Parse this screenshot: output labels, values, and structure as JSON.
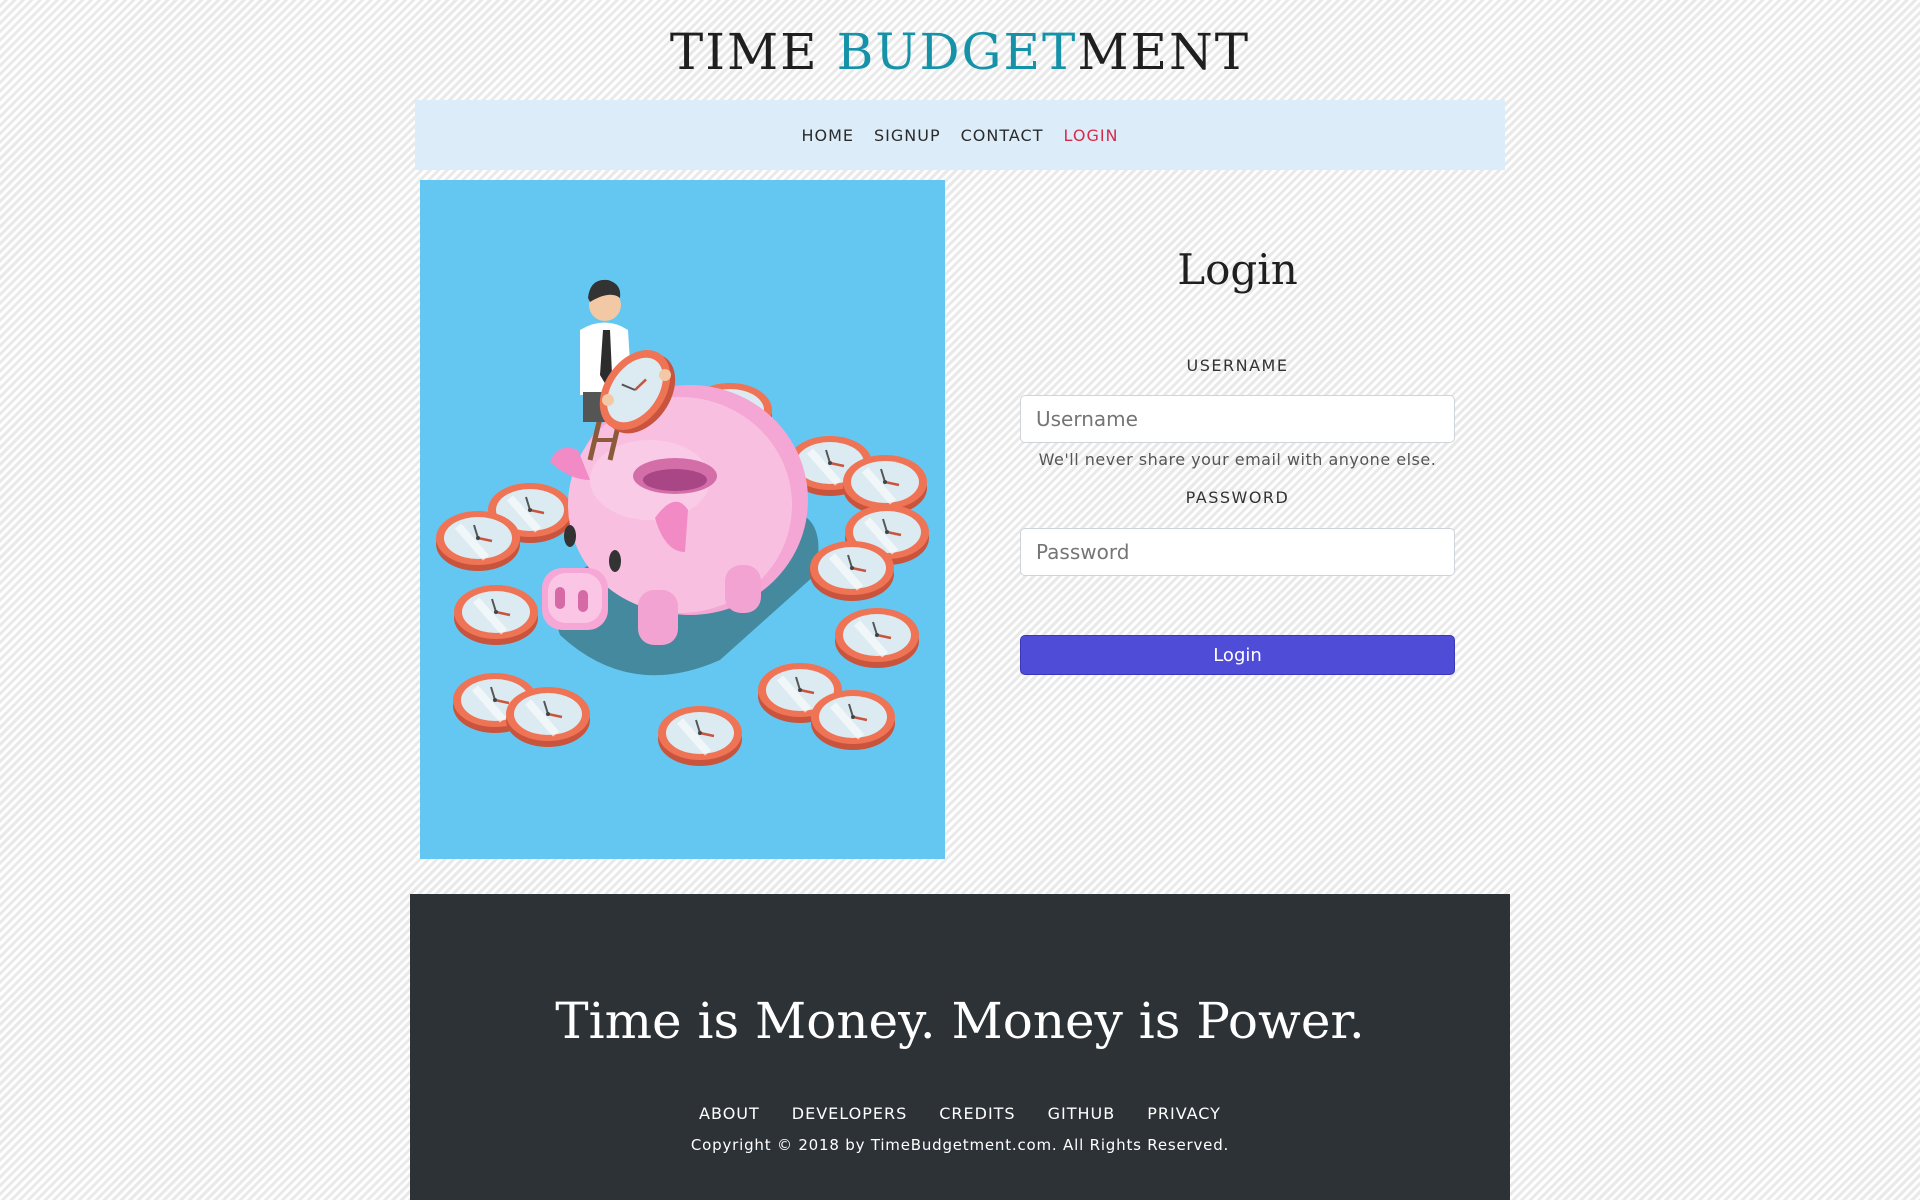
{
  "brand": {
    "part1": "TIME ",
    "part2": "BUDGET",
    "part3": "MENT"
  },
  "nav": {
    "items": [
      "HOME",
      "SIGNUP",
      "CONTACT",
      "LOGIN"
    ],
    "active": "LOGIN"
  },
  "login": {
    "title": "Login",
    "username_label": "USERNAME",
    "username_placeholder": "Username",
    "help_text": "We'll never share your email with anyone else.",
    "password_label": "PASSWORD",
    "password_placeholder": "Password",
    "button_label": "Login"
  },
  "footer": {
    "tagline": "Time is Money. Money is Power.",
    "links": [
      "ABOUT",
      "DEVELOPERS",
      "CREDITS",
      "GITHUB",
      "PRIVACY"
    ],
    "copyright": "Copyright © 2018 by TimeBudgetment.com. All Rights Reserved."
  },
  "colors": {
    "accent": "#1592a8",
    "nav_bg": "#dcecf9",
    "active_link": "#d72a4b",
    "button": "#4f4cd8",
    "hero_bg": "#63c7f2",
    "footer_bg": "#2d3236"
  },
  "hero": {
    "illustration": "piggy-bank-with-clocks-illustration"
  }
}
